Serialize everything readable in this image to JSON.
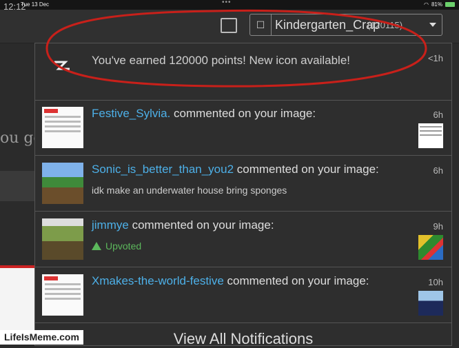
{
  "status_bar": {
    "time": "12:12",
    "date": "Tue 13 Dec",
    "battery": "81%"
  },
  "topbar": {
    "user_name": "Kindergarten_Crap",
    "user_points": "(120115)"
  },
  "background": {
    "partial_text": "ou get"
  },
  "notifications": [
    {
      "message": "You've earned 120000 points! New icon available!",
      "time": "<1h",
      "icon": "bolt-icon"
    },
    {
      "user": "Festive_Sylvia.",
      "message": " commented on your image:",
      "sub": "",
      "time": "6h"
    },
    {
      "user": "Sonic_is_better_than_you2",
      "message": " commented on your image:",
      "sub": "idk make an underwater house bring sponges",
      "time": "6h"
    },
    {
      "user": "jimmye",
      "message": " commented on your image:",
      "sub": "Upvoted",
      "time": "9h"
    },
    {
      "user": "Xmakes-the-world-festive",
      "message": " commented on your image:",
      "sub": "",
      "time": "10h"
    }
  ],
  "view_all_label": "View All Notifications",
  "watermark": "LifeIsMeme.com",
  "colors": {
    "username": "#4db0e8",
    "upvoted": "#5cb85c",
    "annotation": "#c8201a"
  }
}
